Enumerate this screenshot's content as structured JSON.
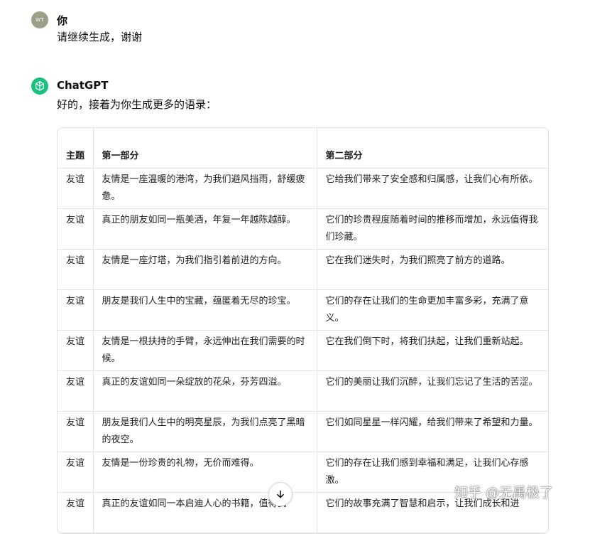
{
  "user_message": {
    "avatar_initials": "WT",
    "author": "你",
    "text": "请继续生成，谢谢"
  },
  "assistant_message": {
    "author": "ChatGPT",
    "text": "好的，接着为你生成更多的语录：",
    "icon": "openai-logo-icon"
  },
  "table": {
    "headers": [
      "主题",
      "第一部分",
      "第二部分"
    ],
    "rows": [
      [
        "友谊",
        "友情是一座温暖的港湾，为我们避风挡雨，舒缓疲惫。",
        "它给我们带来了安全感和归属感，让我们心有所依。"
      ],
      [
        "友谊",
        "真正的朋友如同一瓶美酒，年复一年越陈越醇。",
        "它们的珍贵程度随着时间的推移而增加，永远值得我们珍藏。"
      ],
      [
        "友谊",
        "友情是一座灯塔，为我们指引着前进的方向。",
        "它在我们迷失时，为我们照亮了前方的道路。"
      ],
      [
        "友谊",
        "朋友是我们人生中的宝藏，蕴匿着无尽的珍宝。",
        "它们的存在让我们的生命更加丰富多彩，充满了意义。"
      ],
      [
        "友谊",
        "友情是一根扶持的手臂，永远伸出在我们需要的时候。",
        "它在我们倒下时，将我们扶起，让我们重新站起。"
      ],
      [
        "友谊",
        "真正的友谊如同一朵绽放的花朵，芬芳四溢。",
        "它们的美丽让我们沉醉，让我们忘记了生活的苦涩。"
      ],
      [
        "友谊",
        "朋友是我们人生中的明亮星辰，为我们点亮了黑暗的夜空。",
        "它们如同星星一样闪耀，给我们带来了希望和力量。"
      ],
      [
        "友谊",
        "友情是一份珍贵的礼物，无价而难得。",
        "它们的存在让我们感到幸福和满足，让我们心存感激。"
      ],
      [
        "友谊",
        "真正的友谊如同一本启迪人心的书籍，值得我",
        "它们的故事充满了智慧和启示，让我们成长和进"
      ]
    ]
  },
  "scroll_button": {
    "icon": "arrow-down-icon"
  },
  "watermark": "知乎 @无禹极了",
  "colors": {
    "gpt_brand": "#19c37d",
    "user_avatar": "#9ea08a",
    "border": "#e3e3e3"
  }
}
